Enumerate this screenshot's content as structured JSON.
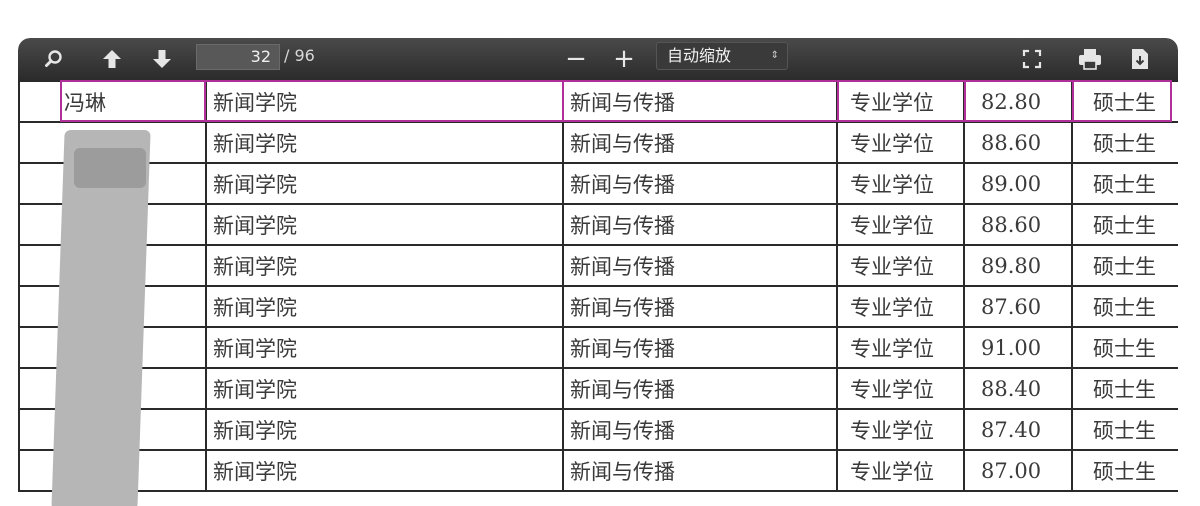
{
  "toolbar": {
    "current_page": "32",
    "total_pages": "/ 96",
    "zoom_minus": "−",
    "zoom_plus": "+",
    "zoom_mode": "自动缩放",
    "zoom_arrow": "⇕"
  },
  "table": {
    "rows": [
      {
        "name": "冯琳",
        "school": "新闻学院",
        "major": "新闻与传播",
        "degree_type": "专业学位",
        "score": "82.80",
        "level": "硕士生"
      },
      {
        "name": "",
        "school": "新闻学院",
        "major": "新闻与传播",
        "degree_type": "专业学位",
        "score": "88.60",
        "level": "硕士生"
      },
      {
        "name": "",
        "school": "新闻学院",
        "major": "新闻与传播",
        "degree_type": "专业学位",
        "score": "89.00",
        "level": "硕士生"
      },
      {
        "name": "",
        "school": "新闻学院",
        "major": "新闻与传播",
        "degree_type": "专业学位",
        "score": "88.60",
        "level": "硕士生"
      },
      {
        "name": "",
        "school": "新闻学院",
        "major": "新闻与传播",
        "degree_type": "专业学位",
        "score": "89.80",
        "level": "硕士生"
      },
      {
        "name": "",
        "school": "新闻学院",
        "major": "新闻与传播",
        "degree_type": "专业学位",
        "score": "87.60",
        "level": "硕士生"
      },
      {
        "name": "",
        "school": "新闻学院",
        "major": "新闻与传播",
        "degree_type": "专业学位",
        "score": "91.00",
        "level": "硕士生"
      },
      {
        "name": "",
        "school": "新闻学院",
        "major": "新闻与传播",
        "degree_type": "专业学位",
        "score": "88.40",
        "level": "硕士生"
      },
      {
        "name": "",
        "school": "新闻学院",
        "major": "新闻与传播",
        "degree_type": "专业学位",
        "score": "87.40",
        "level": "硕士生"
      },
      {
        "name": "",
        "school": "新闻学院",
        "major": "新闻与传播",
        "degree_type": "专业学位",
        "score": "87.00",
        "level": "硕士生"
      }
    ]
  },
  "colors": {
    "highlight": "#b0309a",
    "toolbar_bg": "#333333",
    "redaction": "#b6b6b6"
  },
  "icons": [
    "search-icon",
    "arrow-up-icon",
    "arrow-down-icon",
    "fullscreen-icon",
    "print-icon",
    "download-icon"
  ]
}
